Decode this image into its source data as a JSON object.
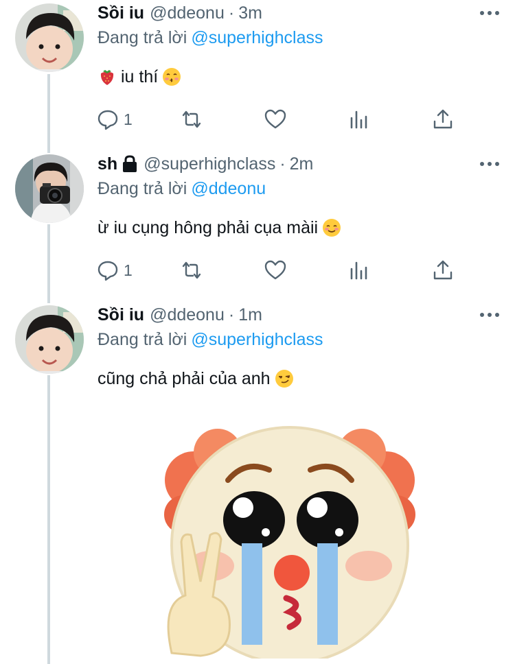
{
  "tweets": [
    {
      "display_name": "Sồi iu",
      "handle": "@ddeonu",
      "separator": "·",
      "time": "3m",
      "reply_prefix": "Đang trả lời",
      "reply_to": "@superhighclass",
      "text": "iu thí",
      "lead_emoji": "strawberry-emoji",
      "trail_emoji": "kissing-face-emoji",
      "reply_count": "1",
      "has_lock": false
    },
    {
      "display_name": "sh",
      "handle": "@superhighclass",
      "separator": "·",
      "time": "2m",
      "reply_prefix": "Đang trả lời",
      "reply_to": "@ddeonu",
      "text": "ừ iu cụng hông phải cụa màii",
      "trail_emoji": "smiling-face-emoji",
      "reply_count": "1",
      "has_lock": true
    },
    {
      "display_name": "Sồi iu",
      "handle": "@ddeonu",
      "separator": "·",
      "time": "1m",
      "reply_prefix": "Đang trả lời",
      "reply_to": "@superhighclass",
      "text": "cũng chả phải của anh",
      "trail_emoji": "smirking-face-emoji",
      "media": "crying-clown-emoji-sticker"
    }
  ],
  "colors": {
    "link": "#1d9bf0",
    "secondary_text": "#536471",
    "thread_line": "#cfd9de",
    "icon": "#536471"
  }
}
